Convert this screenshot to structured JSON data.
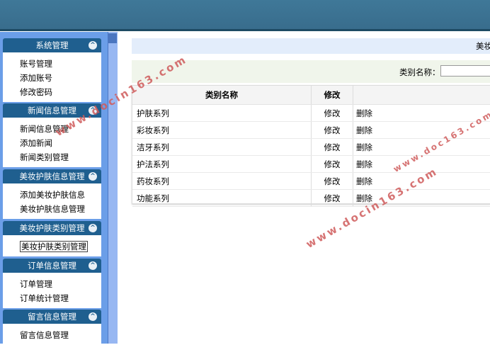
{
  "sidebar": {
    "sections": [
      {
        "title": "系统管理",
        "items": [
          "账号管理",
          "添加账号",
          "修改密码"
        ]
      },
      {
        "title": "新闻信息管理",
        "items": [
          "新闻信息管理",
          "添加新闻",
          "新闻类别管理"
        ]
      },
      {
        "title": "美妆护肤信息管理",
        "items": [
          "添加美妆护肤信息",
          "美妆护肤信息管理"
        ]
      },
      {
        "title": "美妆护肤类别管理",
        "items": [
          "美妆护肤类别管理"
        ]
      },
      {
        "title": "订单信息管理",
        "items": [
          "订单管理",
          "订单统计管理"
        ]
      },
      {
        "title": "留言信息管理",
        "items": [
          "留言信息管理"
        ]
      }
    ],
    "collapse_glyph": "^"
  },
  "content": {
    "title": "美妆护肤",
    "search": {
      "label": "类别名称：",
      "value": ""
    },
    "table": {
      "headers": [
        "类别名称",
        "修改",
        ""
      ],
      "rows": [
        {
          "name": "护肤系列",
          "edit": "修改",
          "delete": "删除"
        },
        {
          "name": "彩妆系列",
          "edit": "修改",
          "delete": "删除"
        },
        {
          "name": "洁牙系列",
          "edit": "修改",
          "delete": "删除"
        },
        {
          "name": "护法系列",
          "edit": "修改",
          "delete": "删除"
        },
        {
          "name": "药妆系列",
          "edit": "修改",
          "delete": "删除"
        },
        {
          "name": "功能系列",
          "edit": "修改",
          "delete": "删除"
        }
      ]
    }
  },
  "watermarks": [
    "www.docin163.com",
    "www.docin163.com",
    "www.doc163.com"
  ],
  "colors": {
    "header": "#3a6f8f",
    "sidebar": "#6b9ee8",
    "panel_head": "#1f5f8f",
    "watermark": "#cf5b5b"
  }
}
